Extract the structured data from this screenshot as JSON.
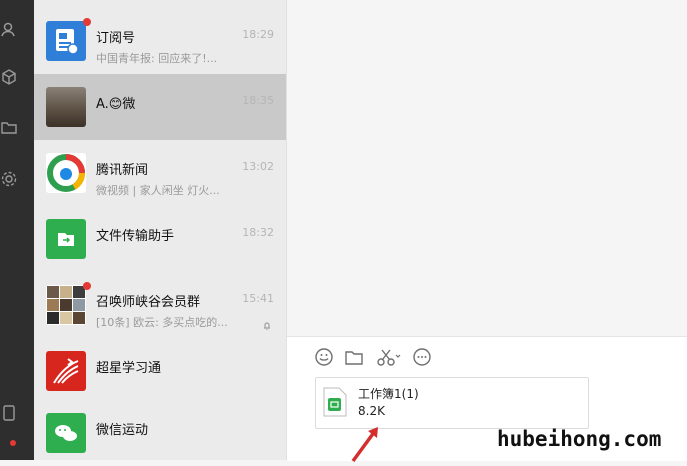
{
  "sidebar": {
    "icons": [
      "people-icon",
      "cube-icon",
      "folder-icon",
      "gear-icon",
      "phone-icon",
      "menu-icon"
    ]
  },
  "conversations": [
    {
      "name": "订阅号",
      "preview": "中国青年报: 回应来了!...",
      "time": "18:29",
      "badge": true
    },
    {
      "name": "A.😊微",
      "preview": "",
      "time": "18:35",
      "selected": true
    },
    {
      "name": "腾讯新闻",
      "preview": "微视频 | 家人闲坐 灯火...",
      "time": "13:02"
    },
    {
      "name": "文件传输助手",
      "preview": "",
      "time": "18:32"
    },
    {
      "name": "召唤师峡谷会员群",
      "preview": "[10条] 欧云: 多买点吃的...",
      "time": "15:41",
      "badge": true,
      "muted": true
    },
    {
      "name": "超星学习通",
      "preview": "",
      "time": ""
    },
    {
      "name": "微信运动",
      "preview": "",
      "time": ""
    }
  ],
  "toolbar": {
    "icons": [
      "emoji-icon",
      "folder-icon",
      "scissors-icon",
      "chat-bubble-icon"
    ]
  },
  "attachment": {
    "file_name": "工作簿1(1)",
    "file_size": "8.2K"
  },
  "watermark": "hubeihong.com",
  "colors": {
    "selected_bg": "#c9c9c9",
    "list_bg": "#ebebeb",
    "rail_bg": "#2e2e2e",
    "badge": "#e53935",
    "arrow": "#d32f2f"
  }
}
